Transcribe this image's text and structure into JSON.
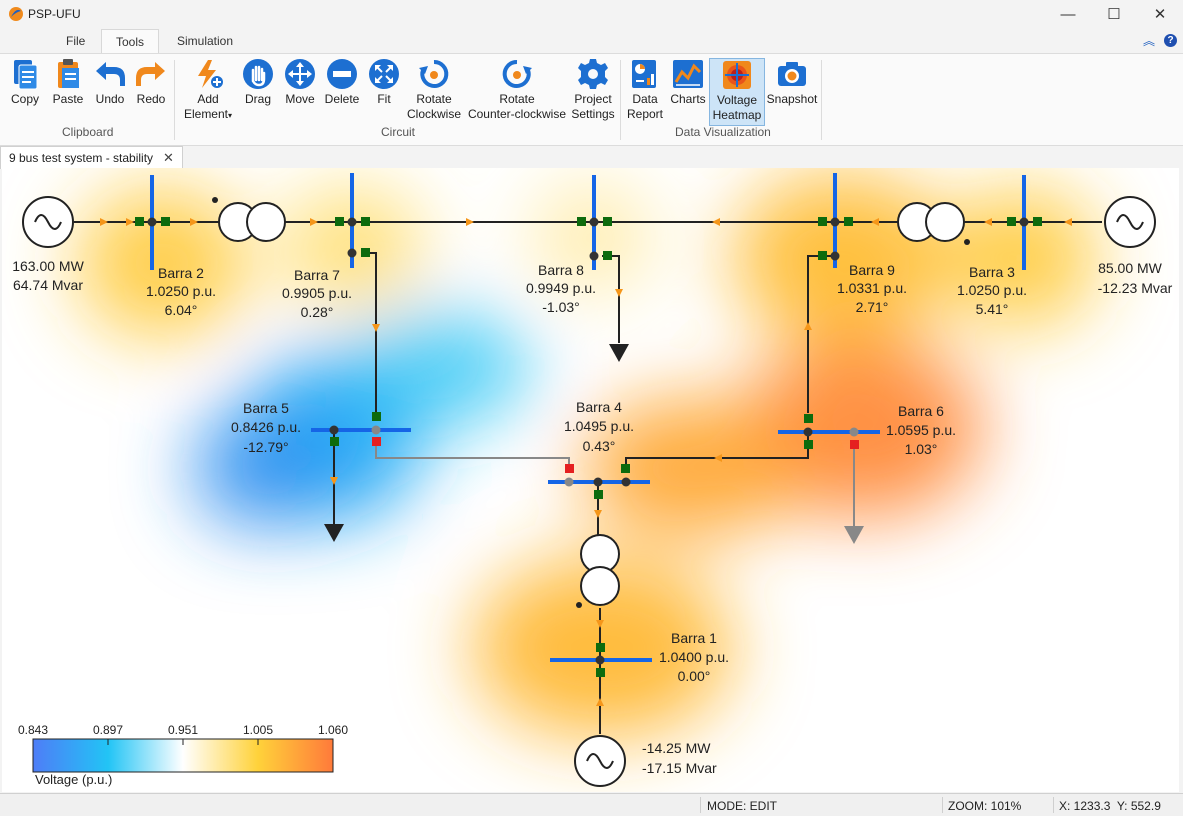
{
  "window": {
    "title": "PSP-UFU",
    "controls": {
      "minimize": "—",
      "maximize": "☐",
      "close": "✕"
    }
  },
  "ribbon_tabs": [
    "File",
    "Tools",
    "Simulation"
  ],
  "ribbon_right": {
    "collapse": "︽",
    "help": "?"
  },
  "groups": {
    "clipboard": {
      "label": "Clipboard",
      "buttons": {
        "copy": "Copy",
        "paste": "Paste",
        "undo": "Undo",
        "redo": "Redo"
      }
    },
    "circuit": {
      "label": "Circuit",
      "buttons": {
        "add": "Add",
        "add2": "Element",
        "drag": "Drag",
        "move": "Move",
        "delete": "Delete",
        "fit": "Fit",
        "rcw1": "Rotate",
        "rcw2": "Clockwise",
        "rccw1": "Rotate",
        "rccw2": "Counter-clockwise",
        "ps1": "Project",
        "ps2": "Settings"
      }
    },
    "dataviz": {
      "label": "Data Visualization",
      "buttons": {
        "dr1": "Data",
        "dr2": "Report",
        "charts": "Charts",
        "vh1": "Voltage",
        "vh2": "Heatmap",
        "snapshot": "Snapshot"
      }
    }
  },
  "document_tab": {
    "title": "9 bus test system - stability",
    "close": "✕"
  },
  "buses": [
    {
      "name": "Barra 2",
      "voltage": "1.0250 p.u.",
      "angle": "6.04°"
    },
    {
      "name": "Barra 7",
      "voltage": "0.9905 p.u.",
      "angle": "0.28°"
    },
    {
      "name": "Barra 8",
      "voltage": "0.9949 p.u.",
      "angle": "-1.03°"
    },
    {
      "name": "Barra 9",
      "voltage": "1.0331 p.u.",
      "angle": "2.71°"
    },
    {
      "name": "Barra 3",
      "voltage": "1.0250 p.u.",
      "angle": "5.41°"
    },
    {
      "name": "Barra 5",
      "voltage": "0.8426 p.u.",
      "angle": "-12.79°"
    },
    {
      "name": "Barra 4",
      "voltage": "1.0495 p.u.",
      "angle": "0.43°"
    },
    {
      "name": "Barra 6",
      "voltage": "1.0595 p.u.",
      "angle": "1.03°"
    },
    {
      "name": "Barra 1",
      "voltage": "1.0400 p.u.",
      "angle": "0.00°"
    }
  ],
  "generators": {
    "g2": {
      "p": "163.00 MW",
      "q": "64.74 Mvar"
    },
    "g3": {
      "p": "85.00 MW",
      "q": "-12.23 Mvar"
    },
    "g1": {
      "p": "-14.25 MW",
      "q": "-17.15 Mvar"
    }
  },
  "legend": {
    "title": "Voltage (p.u.)",
    "ticks": [
      "0.843",
      "0.897",
      "0.951",
      "1.005",
      "1.060"
    ],
    "colors": [
      "#4e7df7",
      "#22c4f5",
      "#ffffff",
      "#ffd23a",
      "#ff7a3a"
    ]
  },
  "status": {
    "mode": "MODE: EDIT",
    "zoom": "ZOOM: 101%",
    "coords": "X: 1233.3  Y: 552.9"
  },
  "colors": {
    "bus": "#1565e6",
    "breaker_closed": "#0d6b0d",
    "breaker_open": "#e52020",
    "flow_arrow": "#f5961a"
  }
}
